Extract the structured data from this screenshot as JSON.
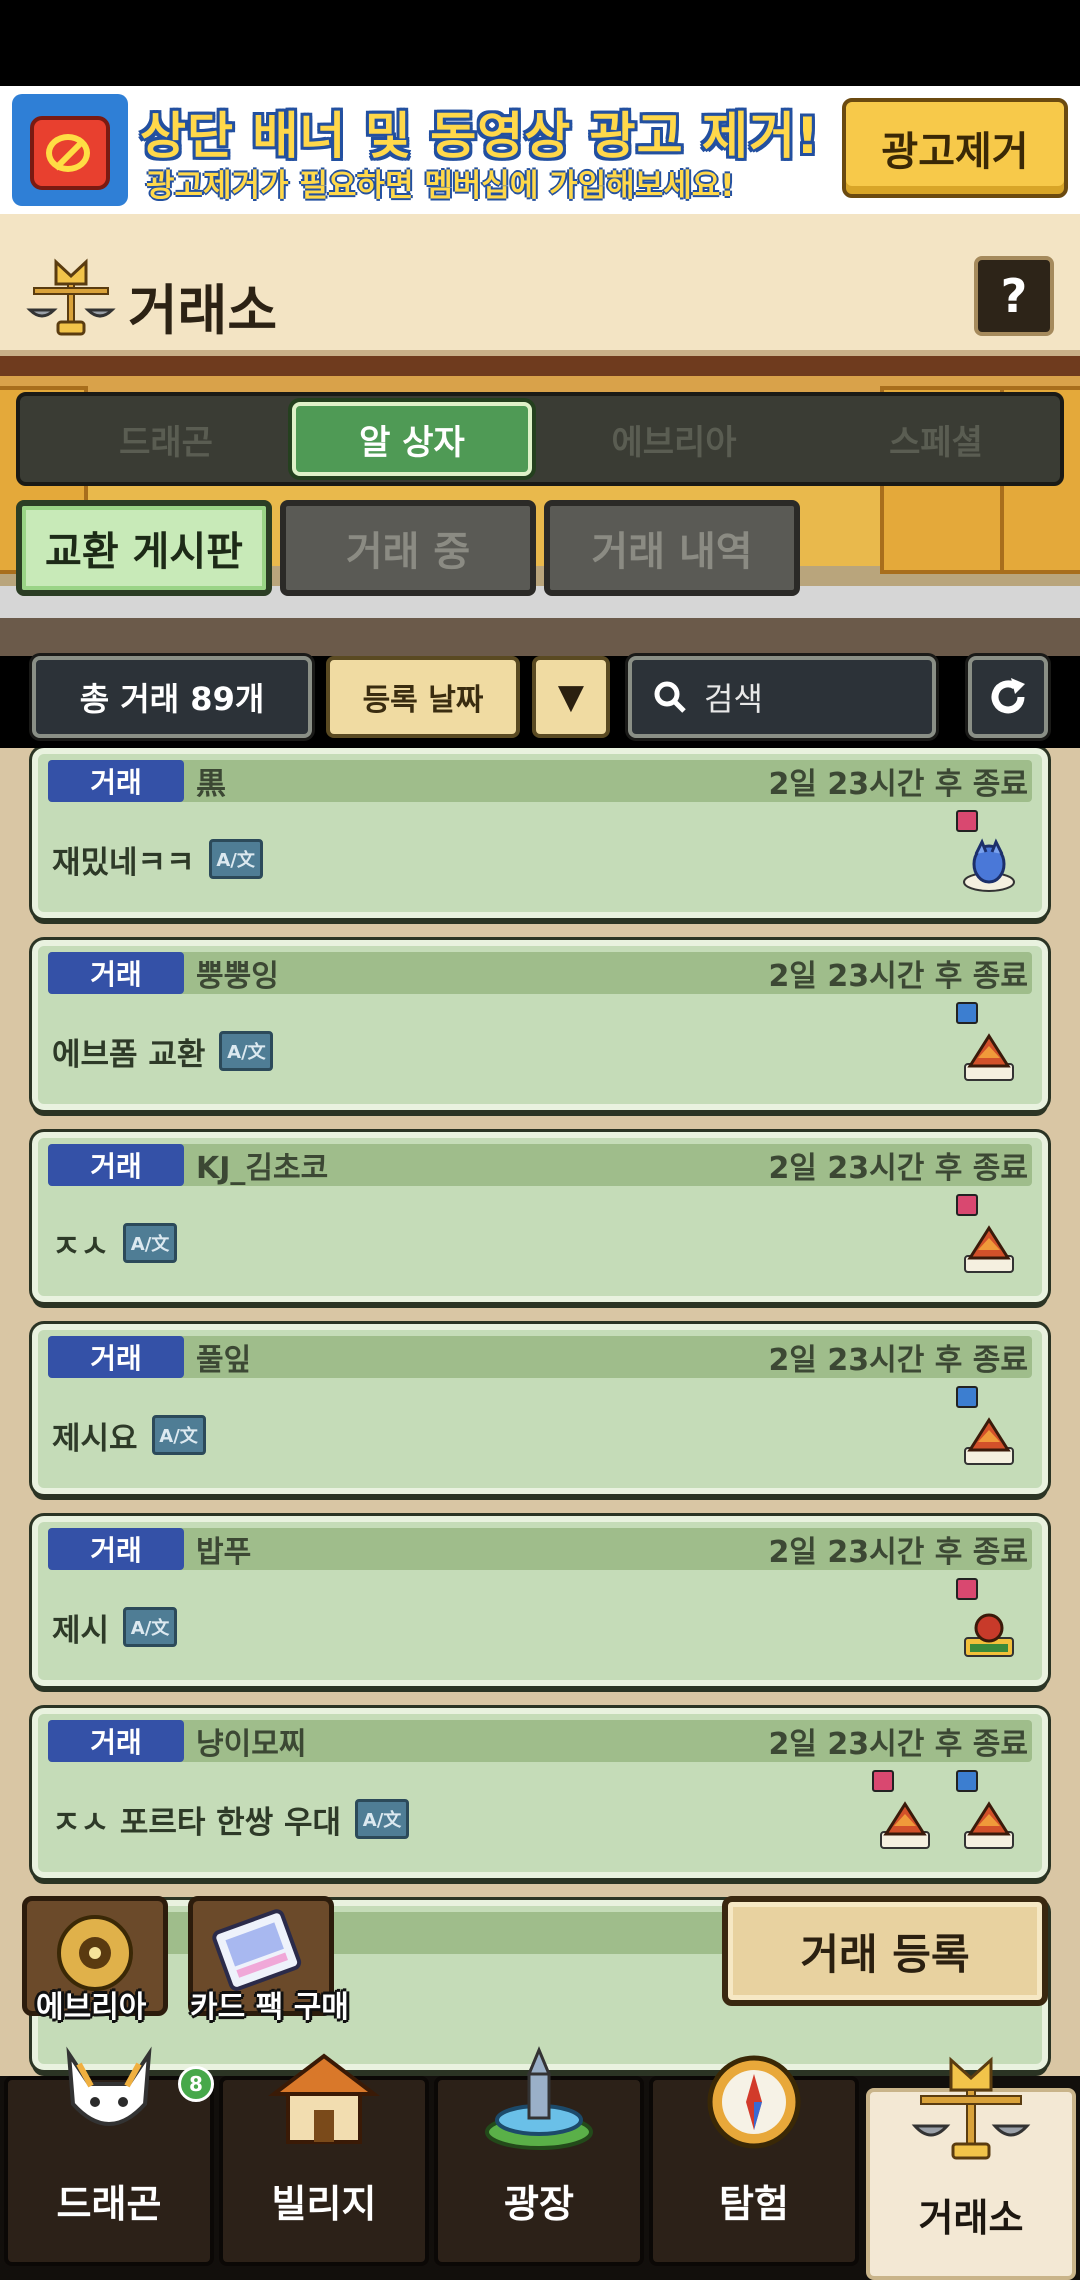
{
  "ad_banner": {
    "title": "상단 배너 및 동영상 광고 제거!",
    "subtitle": "광고제거가 필요하면 멤버십에 가입해보세요!",
    "button_label": "광고제거"
  },
  "header": {
    "title": "거래소",
    "help_label": "?"
  },
  "category_tabs": [
    {
      "label": "드래곤",
      "active": false
    },
    {
      "label": "알 상자",
      "active": true
    },
    {
      "label": "에브리아",
      "active": false
    },
    {
      "label": "스페셜",
      "active": false
    }
  ],
  "sub_tabs": [
    {
      "label": "교환 게시판",
      "active": true
    },
    {
      "label": "거래 중",
      "active": false
    },
    {
      "label": "거래 내역",
      "active": false
    }
  ],
  "toolbar": {
    "total_label": "총 거래 89개",
    "sort_label": "등록 날짜",
    "sort_arrow": "▼",
    "search_placeholder": "검색"
  },
  "trades": [
    {
      "badge": "거래",
      "seller": "黒",
      "time": "2일 23시간 후 종료",
      "message": "재밌네ㅋㅋ",
      "eggs": [
        "f"
      ]
    },
    {
      "badge": "거래",
      "seller": "뿡뿡잉",
      "time": "2일 23시간 후 종료",
      "message": "에브폼 교환",
      "eggs": [
        "m"
      ]
    },
    {
      "badge": "거래",
      "seller": "KJ_김초코",
      "time": "2일 23시간 후 종료",
      "message": "ㅈㅅ",
      "eggs": [
        "f"
      ]
    },
    {
      "badge": "거래",
      "seller": "풀잎",
      "time": "2일 23시간 후 종료",
      "message": "제시요",
      "eggs": [
        "m"
      ]
    },
    {
      "badge": "거래",
      "seller": "밥푸",
      "time": "2일 23시간 후 종료",
      "message": "제시",
      "eggs": [
        "f"
      ]
    },
    {
      "badge": "거래",
      "seller": "냥이모찌",
      "time": "2일 23시간 후 종료",
      "message": "ㅈㅅ 포르타 한쌍 우대",
      "eggs": [
        "f",
        "m"
      ]
    }
  ],
  "translate_icon_text": "A/文",
  "floating": {
    "everia_label": "에브리아",
    "card_pack_label": "카드 팩 구매",
    "register_label": "거래 등록"
  },
  "bottom_nav": [
    {
      "label": "드래곤",
      "icon": "dragon-icon",
      "badge": "8",
      "active": false
    },
    {
      "label": "빌리지",
      "icon": "village-icon",
      "active": false
    },
    {
      "label": "광장",
      "icon": "fountain-icon",
      "active": false
    },
    {
      "label": "탐험",
      "icon": "compass-icon",
      "active": false
    },
    {
      "label": "거래소",
      "icon": "scale-icon",
      "active": true
    }
  ],
  "colors": {
    "accent_green": "#4f9a55",
    "badge_blue": "#3451a7",
    "card_bg": "#c5dcb8",
    "female": "#d94870",
    "male": "#3c7ed0"
  }
}
